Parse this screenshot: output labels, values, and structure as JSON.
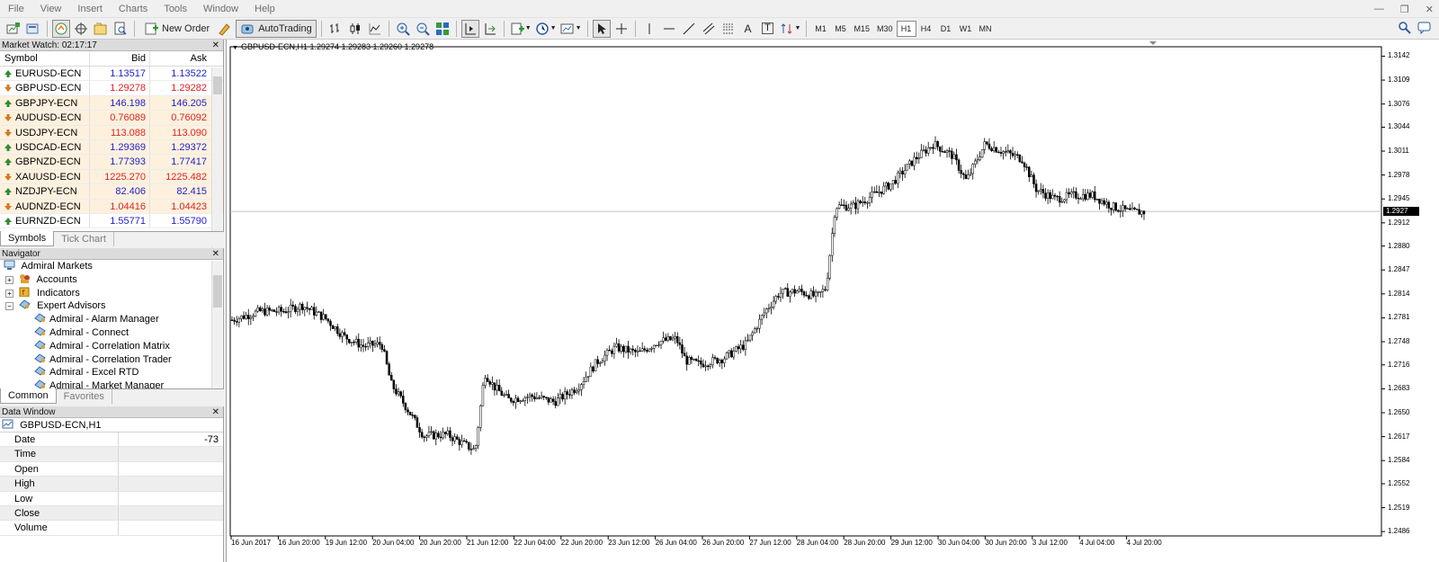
{
  "menu": [
    "File",
    "View",
    "Insert",
    "Charts",
    "Tools",
    "Window",
    "Help"
  ],
  "toolbar": {
    "new_order": "New Order",
    "auto_trading": "AutoTrading",
    "timeframes": [
      "M1",
      "M5",
      "M15",
      "M30",
      "H1",
      "H4",
      "D1",
      "W1",
      "MN"
    ],
    "active_timeframe": "H1",
    "text_tool": "A",
    "text_label_tool": "T"
  },
  "market_watch": {
    "title": "Market Watch: 02:17:17",
    "headers": {
      "symbol": "Symbol",
      "bid": "Bid",
      "ask": "Ask"
    },
    "rows": [
      {
        "symbol": "EURUSD-ECN",
        "bid": "1.13517",
        "ask": "1.13522",
        "dir": "up",
        "color": "blue"
      },
      {
        "symbol": "GBPUSD-ECN",
        "bid": "1.29278",
        "ask": "1.29282",
        "dir": "down",
        "color": "red"
      },
      {
        "symbol": "GBPJPY-ECN",
        "bid": "146.198",
        "ask": "146.205",
        "dir": "up",
        "color": "blue"
      },
      {
        "symbol": "AUDUSD-ECN",
        "bid": "0.76089",
        "ask": "0.76092",
        "dir": "down",
        "color": "red"
      },
      {
        "symbol": "USDJPY-ECN",
        "bid": "113.088",
        "ask": "113.090",
        "dir": "down",
        "color": "red"
      },
      {
        "symbol": "USDCAD-ECN",
        "bid": "1.29369",
        "ask": "1.29372",
        "dir": "up",
        "color": "blue"
      },
      {
        "symbol": "GBPNZD-ECN",
        "bid": "1.77393",
        "ask": "1.77417",
        "dir": "up",
        "color": "blue"
      },
      {
        "symbol": "XAUUSD-ECN",
        "bid": "1225.270",
        "ask": "1225.482",
        "dir": "down",
        "color": "red"
      },
      {
        "symbol": "NZDJPY-ECN",
        "bid": "82.406",
        "ask": "82.415",
        "dir": "up",
        "color": "blue"
      },
      {
        "symbol": "AUDNZD-ECN",
        "bid": "1.04416",
        "ask": "1.04423",
        "dir": "down",
        "color": "red"
      },
      {
        "symbol": "EURNZD-ECN",
        "bid": "1.55771",
        "ask": "1.55790",
        "dir": "up",
        "color": "blue"
      }
    ],
    "tabs": [
      "Symbols",
      "Tick Chart"
    ]
  },
  "navigator": {
    "title": "Navigator",
    "root": "Admiral Markets",
    "accounts": "Accounts",
    "indicators": "Indicators",
    "expert_advisors": "Expert Advisors",
    "items": [
      "Admiral - Alarm Manager",
      "Admiral - Connect",
      "Admiral - Correlation Matrix",
      "Admiral - Correlation Trader",
      "Admiral - Excel RTD",
      "Admiral - Market Manager"
    ],
    "tabs": [
      "Common",
      "Favorites"
    ]
  },
  "data_window": {
    "title": "Data Window",
    "symbol": "GBPUSD-ECN,H1",
    "rows": [
      {
        "name": "Date",
        "value": "-73"
      },
      {
        "name": "Time",
        "value": ""
      },
      {
        "name": "Open",
        "value": ""
      },
      {
        "name": "High",
        "value": ""
      },
      {
        "name": "Low",
        "value": ""
      },
      {
        "name": "Close",
        "value": ""
      },
      {
        "name": "Volume",
        "value": ""
      }
    ]
  },
  "chart": {
    "title": "GBPUSD-ECN,H1  1.29274 1.29283 1.29260 1.29278",
    "price_tag": "1.2927",
    "background": "#ffffff",
    "candle_color": "#000000",
    "bid_line_color": "#c0c0c0"
  },
  "chart_data": {
    "type": "candlestick",
    "symbol": "GBPUSD-ECN",
    "timeframe": "H1",
    "current_price": 1.29278,
    "ylim": [
      1.248,
      1.3155
    ],
    "y_ticks": [
      "1.3142",
      "1.3109",
      "1.3076",
      "1.3044",
      "1.3011",
      "1.2978",
      "1.2945",
      "1.2912",
      "1.2880",
      "1.2847",
      "1.2814",
      "1.2781",
      "1.2748",
      "1.2716",
      "1.2683",
      "1.2650",
      "1.2617",
      "1.2584",
      "1.2552",
      "1.2519",
      "1.2486"
    ],
    "x_ticks": [
      "16 Jun 2017",
      "16 Jun 20:00",
      "19 Jun 12:00",
      "20 Jun 04:00",
      "20 Jun 20:00",
      "21 Jun 12:00",
      "22 Jun 04:00",
      "22 Jun 20:00",
      "23 Jun 12:00",
      "26 Jun 04:00",
      "26 Jun 20:00",
      "27 Jun 12:00",
      "28 Jun 04:00",
      "28 Jun 20:00",
      "29 Jun 12:00",
      "30 Jun 04:00",
      "30 Jun 20:00",
      "3 Jul 12:00",
      "4 Jul 04:00",
      "4 Jul 20:00"
    ],
    "close_path": [
      [
        0,
        1.2778
      ],
      [
        6,
        1.279
      ],
      [
        11,
        1.279
      ],
      [
        15,
        1.2798
      ],
      [
        20,
        1.278
      ],
      [
        24,
        1.2755
      ],
      [
        28,
        1.2742
      ],
      [
        32,
        1.2745
      ],
      [
        34,
        1.269
      ],
      [
        38,
        1.265
      ],
      [
        41,
        1.2618
      ],
      [
        46,
        1.262
      ],
      [
        50,
        1.2605
      ],
      [
        52,
        1.2598
      ],
      [
        54,
        1.2705
      ],
      [
        56,
        1.2686
      ],
      [
        59,
        1.2668
      ],
      [
        64,
        1.2673
      ],
      [
        69,
        1.2665
      ],
      [
        74,
        1.2686
      ],
      [
        78,
        1.272
      ],
      [
        82,
        1.274
      ],
      [
        87,
        1.2732
      ],
      [
        91,
        1.2748
      ],
      [
        95,
        1.2752
      ],
      [
        97,
        1.2722
      ],
      [
        100,
        1.2717
      ],
      [
        105,
        1.2725
      ],
      [
        110,
        1.2745
      ],
      [
        114,
        1.279
      ],
      [
        117,
        1.2815
      ],
      [
        121,
        1.2818
      ],
      [
        125,
        1.281
      ],
      [
        127,
        1.2822
      ],
      [
        129,
        1.2935
      ],
      [
        133,
        1.2935
      ],
      [
        137,
        1.295
      ],
      [
        141,
        1.2966
      ],
      [
        146,
        1.3
      ],
      [
        150,
        1.3021
      ],
      [
        154,
        1.3005
      ],
      [
        157,
        1.297
      ],
      [
        161,
        1.3021
      ],
      [
        165,
        1.301
      ],
      [
        169,
        1.3
      ],
      [
        172,
        1.2958
      ],
      [
        176,
        1.2945
      ],
      [
        180,
        1.295
      ],
      [
        184,
        1.295
      ],
      [
        188,
        1.2935
      ],
      [
        192,
        1.2927
      ],
      [
        195,
        1.2927
      ]
    ]
  }
}
